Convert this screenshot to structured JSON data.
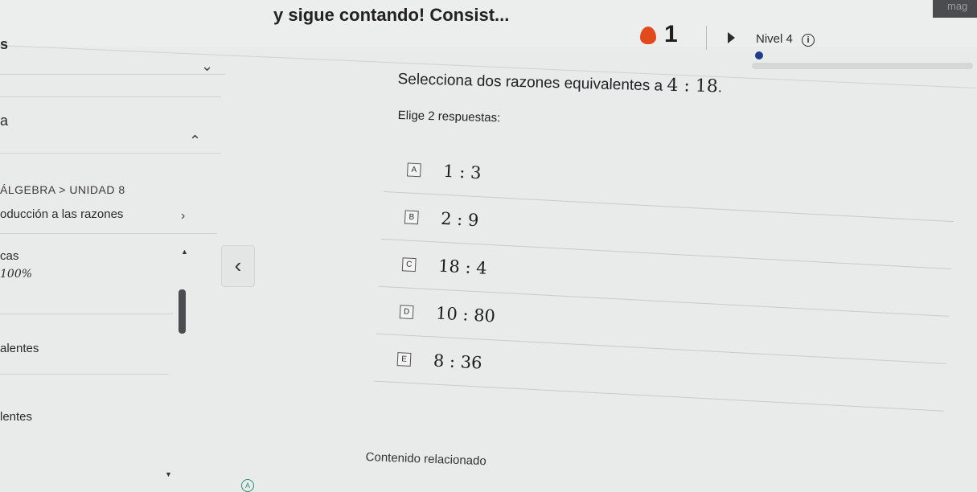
{
  "header": {
    "lesson_title": "y sigue contando! Consist...",
    "streak_count": "1",
    "level_label": "Nivel 4",
    "info_icon": "i",
    "corner_text": "mag",
    "progress": 0.02
  },
  "sidebar": {
    "top_letter": "s",
    "section_letter": "a",
    "breadcrumb": "ÁLGEBRA > UNIDAD 8",
    "unit_title": "oducción a las razones",
    "cas_label": "cas",
    "percent": "100%",
    "item1": "alentes",
    "item2": "lentes"
  },
  "question": {
    "prompt": "Selecciona dos razones equivalentes a",
    "ratio": "4 : 18",
    "period": ".",
    "instruction": "Elige 2 respuestas:",
    "choices": [
      {
        "letter": "A",
        "value": "1 : 3"
      },
      {
        "letter": "B",
        "value": "2 : 9"
      },
      {
        "letter": "C",
        "value": "18 : 4"
      },
      {
        "letter": "D",
        "value": "10 : 80"
      },
      {
        "letter": "E",
        "value": "8 : 36"
      }
    ]
  },
  "footer": {
    "related": "Contenido relacionado",
    "mini_icon": "A"
  },
  "colors": {
    "flame": "#e24a1c",
    "progress": "#1f3c8c"
  }
}
